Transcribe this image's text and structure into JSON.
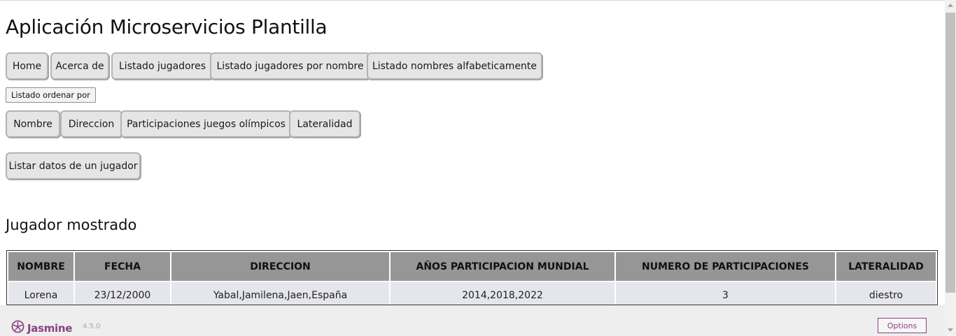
{
  "header": {
    "title": "Aplicación Microservicios Plantilla"
  },
  "nav": [
    "Home",
    "Acerca de",
    "Listado jugadores",
    "Listado jugadores por nombre",
    "Listado nombres alfabeticamente"
  ],
  "order_label": "Listado ordenar por",
  "order_buttons": [
    "Nombre",
    "Direccion",
    "Participaciones juegos olímpicos",
    "Lateralidad"
  ],
  "detail_button": "Listar datos de un jugador",
  "section_title": "Jugador mostrado",
  "table": {
    "headers": [
      "NOMBRE",
      "FECHA",
      "DIRECCION",
      "AÑOS PARTICIPACION MUNDIAL",
      "NUMERO DE PARTICIPACIONES",
      "LATERALIDAD"
    ],
    "rows": [
      [
        "Lorena",
        "23/12/2000",
        "Yabal,Jamilena,Jaen,España",
        "2014,2018,2022",
        "3",
        "diestro"
      ]
    ]
  },
  "footer": {
    "logo_text": "Jasmine",
    "logo_icon": "jasmine-flower-icon",
    "version": "4.5.0",
    "options_label": "Options"
  },
  "colors": {
    "button_bg": "#e5e5e5",
    "table_header_bg": "#969696",
    "table_cell_bg": "#e5e5ee",
    "jasmine_purple": "#8a4182"
  }
}
